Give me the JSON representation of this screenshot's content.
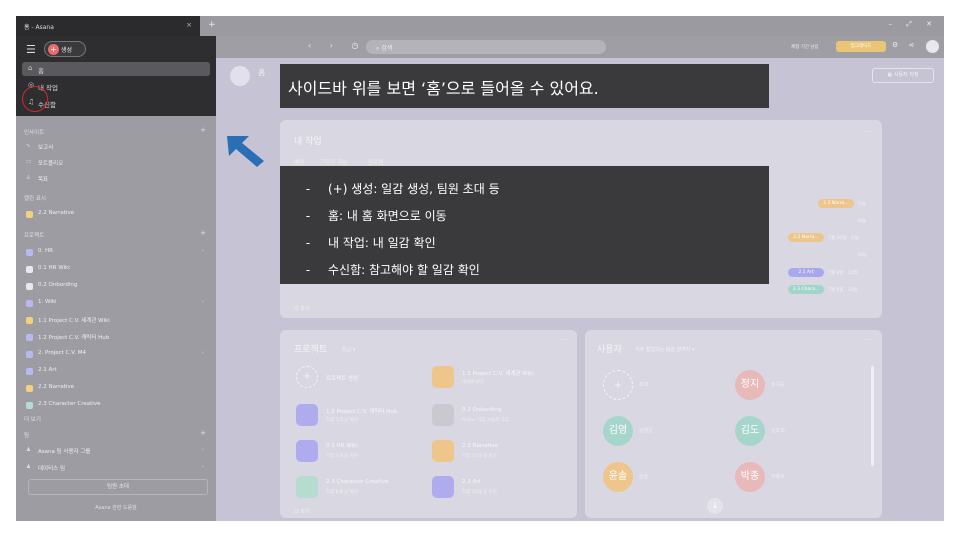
{
  "window": {
    "tab_title": "홈 - Asana",
    "tab_close": "×",
    "new_tab": "+",
    "controls": "– ⤢ ✕"
  },
  "sidebar": {
    "create_label": "생성",
    "nav": [
      {
        "label": "홈",
        "icon": "home-icon",
        "glyph": "⌂"
      },
      {
        "label": "내 작업",
        "icon": "check-circle-icon",
        "glyph": "◎"
      },
      {
        "label": "수신함",
        "icon": "bell-icon",
        "glyph": "♫"
      }
    ],
    "insights_header": "인사이트",
    "insights": [
      {
        "label": "보고서",
        "glyph": "∿"
      },
      {
        "label": "포트폴리오",
        "glyph": "▭"
      },
      {
        "label": "목표",
        "glyph": "♙"
      }
    ],
    "favorites_header": "캘린 표시",
    "favorites": [
      {
        "label": "2.2 Narrative",
        "color": "y"
      }
    ],
    "projects_header": "프로젝트",
    "projects": [
      {
        "label": "0. HR",
        "kind": "folder",
        "chev": true
      },
      {
        "label": "0.1 HR Wiki",
        "kind": "dot"
      },
      {
        "label": "0.2 Onbording",
        "kind": "dot"
      },
      {
        "label": "1. Wiki",
        "kind": "folder",
        "chev": true
      },
      {
        "label": "1.1 Project C.V. 세계관 Wiki",
        "kind": "y"
      },
      {
        "label": "1.2 Project C.V. 캐릭터 Hub",
        "kind": "b"
      },
      {
        "label": "2. Project C.V. M4",
        "kind": "folder",
        "chev": true
      },
      {
        "label": "2.1 Art",
        "kind": "dot"
      },
      {
        "label": "2.2 Narrative",
        "kind": "y"
      },
      {
        "label": "2.3 Character Creative",
        "kind": "b"
      }
    ],
    "more_label": "더 보기",
    "team_header": "팀",
    "teams": [
      {
        "label": "Asana 팀 사용자 그룹",
        "chev": true
      },
      {
        "label": "데이터스 팀",
        "chev": true
      }
    ],
    "invite_label": "팀원 초대",
    "footer": "Asana 관련 도움말"
  },
  "topbar": {
    "search_placeholder": "검색",
    "trial_text": "체험 기간 남음",
    "upgrade_label": "업그레이드"
  },
  "main": {
    "customize_label": "사용자 지정",
    "my_tasks": {
      "title": "내 작업",
      "tabs": [
        "예정",
        "기한이 지남",
        "완료됨"
      ],
      "pills": [
        {
          "label": "2.2 Narra...",
          "date": "오늘",
          "color": "#eec58a"
        },
        {
          "label": "",
          "date": "오늘",
          "color": ""
        },
        {
          "label": "2.2 Narra...",
          "date": "7월 10일 - 오늘",
          "color": "#eec58a"
        },
        {
          "label": "",
          "date": "오늘",
          "color": ""
        },
        {
          "label": "2.1 Art",
          "date": "7월 8일 - 12일",
          "color": "#a9a7ee"
        },
        {
          "label": "2.3 Chara...",
          "date": "7월 6일 - 12일",
          "color": "#9fd6c9"
        }
      ],
      "more": "더 보기"
    },
    "projects_card": {
      "title": "프로젝트",
      "sub": "최근 ▾",
      "items": [
        {
          "name": "프로젝트 생성",
          "meta": "",
          "tile": "plus"
        },
        {
          "name": "1.1 Project C.V. 세계관 Wiki",
          "meta": "네이버 보관",
          "tile": "#eec58a"
        },
        {
          "name": "1.2 Project C.V. 캐릭터 Hub",
          "meta": "작업 1개 곧 마감",
          "tile": "#aeacef"
        },
        {
          "name": "0.2 Onbording",
          "meta": "Asana 작업 사용자 그룹",
          "tile": "#c9c9cf"
        },
        {
          "name": "0.1 HR Wiki",
          "meta": "작업 1개 곧 마감",
          "tile": "#aeacef"
        },
        {
          "name": "2.2 Narrative",
          "meta": "작업 10개 곧 마감",
          "tile": "#eec58a"
        },
        {
          "name": "2.3 Character Creative",
          "meta": "작업 6개 곧 마감",
          "tile": "#b5dccf"
        },
        {
          "name": "2.1 Art",
          "meta": "작업 14개 곧 마감",
          "tile": "#aeacef"
        }
      ],
      "more": "더 보기"
    },
    "users_card": {
      "title": "사용자",
      "sub": "자주 협업하는 팀원 참여자 ▾",
      "invite_label": "초대",
      "users": [
        {
          "short": "정지",
          "name": "정지윤",
          "color": "#e8b9b9"
        },
        {
          "short": "김영",
          "name": "김영준",
          "color": "#a6d6cb"
        },
        {
          "short": "김도",
          "name": "김도희",
          "color": "#a6d6cb"
        },
        {
          "short": "윤솔",
          "name": "윤솔",
          "color": "#eec58a"
        },
        {
          "short": "박종",
          "name": "박종호",
          "color": "#e8b9b9"
        }
      ]
    }
  },
  "overlay": {
    "title": "사이드바 위를 보면 ‘홈’으로 들어올 수 있어요.",
    "bullets": [
      "(+) 생성: 일감 생성, 팀원 초대 등",
      "홈: 내 홈 화면으로 이동",
      "내 작업: 내 일감 확인",
      "수신함: 참고해야 할 일감 확인"
    ],
    "dash": "-"
  },
  "colors": {
    "sidebar_dark": "#2e2e31",
    "overlay_box": "#3a3a3c",
    "arrow": "#2a6fb5",
    "highlight_ring": "#d6262c",
    "create_plus": "#f06a6a"
  }
}
